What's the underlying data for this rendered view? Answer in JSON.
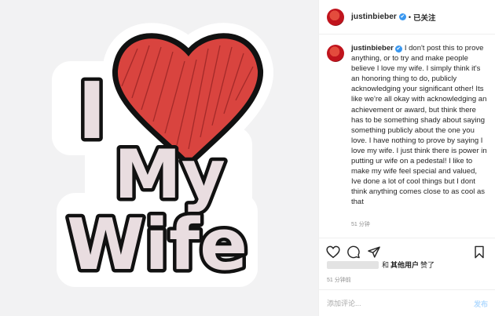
{
  "header": {
    "username": "justinbieber",
    "separator": "•",
    "follow_status": "已关注",
    "verified_glyph": "✔"
  },
  "image": {
    "line1": "I",
    "line2": "My",
    "line3": "Wife"
  },
  "caption": {
    "username": "justinbieber",
    "text": "I don't post this to prove anything, or to try and make people believe I love my wife. I simply think it's an honoring thing to do, publicly acknowledging your significant other! Its like we're all okay with acknowledging an achievement or award, but think there has to be something shady about saying something publicly about the one you love. I have nothing to prove by saying I love my wife. I just think there is power in putting ur wife on a pedestal! I like to make my wife feel special and valued, Ive done a lot of cool things but I dont think anything comes close to as cool as that",
    "time": "51 分钟"
  },
  "likes": {
    "connector": "和",
    "others": "其他用户",
    "suffix": "赞了"
  },
  "post_time": "51 分钟前",
  "comment_box": {
    "placeholder": "添加评论...",
    "post_label": "发布"
  },
  "colors": {
    "heart": "#d9443f",
    "sticker_text": "#e9dde0",
    "outline": "#111111"
  },
  "icons": [
    "heart-icon",
    "comment-icon",
    "share-icon",
    "bookmark-icon",
    "verified-badge-icon"
  ]
}
